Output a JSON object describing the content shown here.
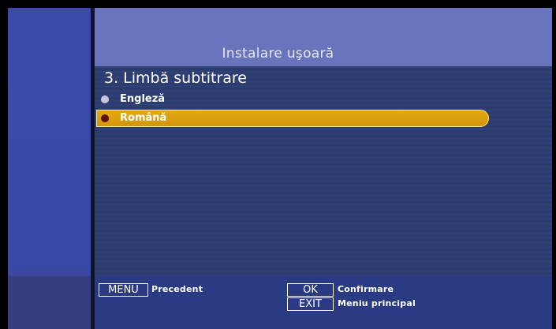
{
  "header": {
    "title": "Instalare uşoară"
  },
  "section": {
    "title": "3. Limbă subtitrare"
  },
  "options": [
    {
      "label": "Engleză",
      "selected": false
    },
    {
      "label": "Română",
      "selected": true
    }
  ],
  "footer": {
    "menu_key": "MENU",
    "menu_desc": "Precedent",
    "ok_key": "OK",
    "ok_desc": "Confirmare",
    "exit_key": "EXIT",
    "exit_desc": "Meniu principal"
  },
  "colors": {
    "header_bg": "#6a74bc",
    "content_bg": "#2f4074",
    "highlight": "#e2a812",
    "footer_bg": "#2a3b84"
  }
}
